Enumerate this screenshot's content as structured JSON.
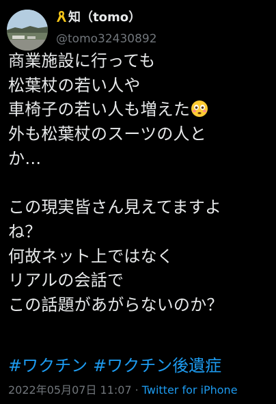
{
  "author": {
    "display_name": "知（tomo）",
    "handle": "@tomo32430892",
    "ribbon_icon": "yellow-ribbon-icon",
    "avatar_desc_icon": "landscape-photo-avatar"
  },
  "tweet": {
    "lines": [
      "商業施設に行っても",
      "松葉杖の若い人や",
      "車椅子の若い人も増えた",
      "外も松葉杖のスーツの人と",
      "か…",
      "",
      "この現実皆さん見えてますよ",
      "ね？",
      "何故ネット上ではなく",
      "リアルの会話で",
      "この話題があがらないのか？"
    ],
    "emoji_icon": "flushed-face-emoji-icon",
    "hashtags": [
      "#ワクチン",
      "#ワクチン後遺症"
    ]
  },
  "meta": {
    "timestamp": "2022年05月07日 11:07",
    "separator": "·",
    "source": "Twitter for iPhone"
  },
  "colors": {
    "background": "#000000",
    "text": "#e7e9ea",
    "secondary": "#71767b",
    "link": "#1d9bf0"
  }
}
